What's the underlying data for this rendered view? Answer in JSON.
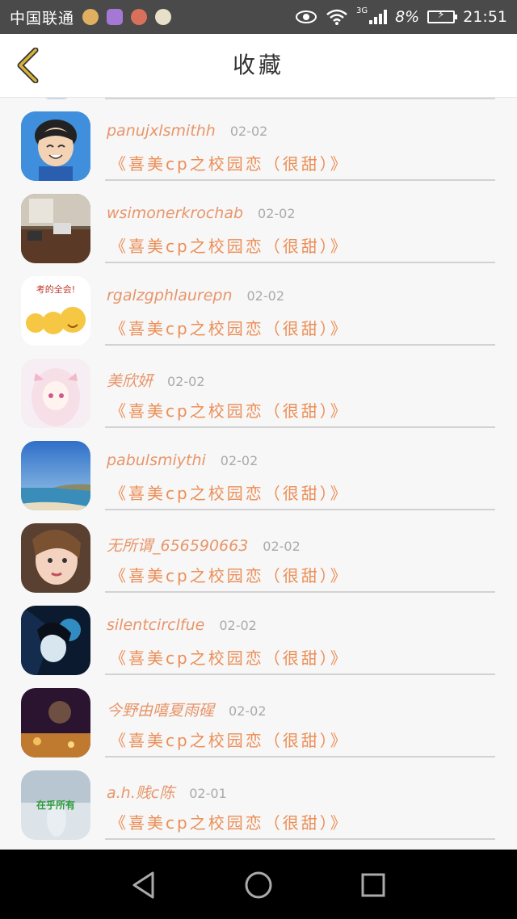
{
  "status_bar": {
    "carrier": "中国联通",
    "network": "3G",
    "battery": "8%",
    "time": "21:51",
    "app_icons": [
      "chat-app-icon",
      "photo-app-icon",
      "game-app-icon",
      "messenger-app-icon"
    ]
  },
  "header": {
    "title": "收藏",
    "back_icon": "chevron-left-icon",
    "accent_color": "#c9a227"
  },
  "list": {
    "name_color": "#e8956a",
    "title_color": "#ec8e56",
    "items": [
      {
        "username": "panujxlsmithh",
        "date": "02-02",
        "book": "《喜美cp之校园恋（很甜）》",
        "avatar": "cartoon-boy-avatar"
      },
      {
        "username": "wsimonerkrochab",
        "date": "02-02",
        "book": "《喜美cp之校园恋（很甜）》",
        "avatar": "desk-photo-avatar"
      },
      {
        "username": "rgalzgphlaurepn",
        "date": "02-02",
        "book": "《喜美cp之校园恋（很甜）》",
        "avatar": "emoji-avatar",
        "avatar_caption": "考的全会!"
      },
      {
        "username": "美欣妍",
        "date": "02-02",
        "book": "《喜美cp之校园恋（很甜）》",
        "avatar": "anime-girl-avatar"
      },
      {
        "username": "pabulsmiythi",
        "date": "02-02",
        "book": "《喜美cp之校园恋（很甜）》",
        "avatar": "beach-avatar"
      },
      {
        "username": "无所谓_656590663",
        "date": "02-02",
        "book": "《喜美cp之校园恋（很甜）》",
        "avatar": "girl-photo-avatar"
      },
      {
        "username": "silentcirclfue",
        "date": "02-02",
        "book": "《喜美cp之校园恋（很甜）》",
        "avatar": "dark-anime-avatar"
      },
      {
        "username": "今野由嘻夏雨䃏",
        "date": "02-02",
        "book": "《喜美cp之校园恋（很甜）》",
        "avatar": "bokeh-avatar"
      },
      {
        "username": "a.h.贱c陈",
        "date": "02-01",
        "book": "《喜美cp之校园恋（很甜）》",
        "avatar": "figure-avatar",
        "avatar_caption": "在乎所有"
      }
    ]
  },
  "nav_bar": {
    "back": "back-triangle-icon",
    "home": "home-circle-icon",
    "recents": "recents-square-icon"
  }
}
